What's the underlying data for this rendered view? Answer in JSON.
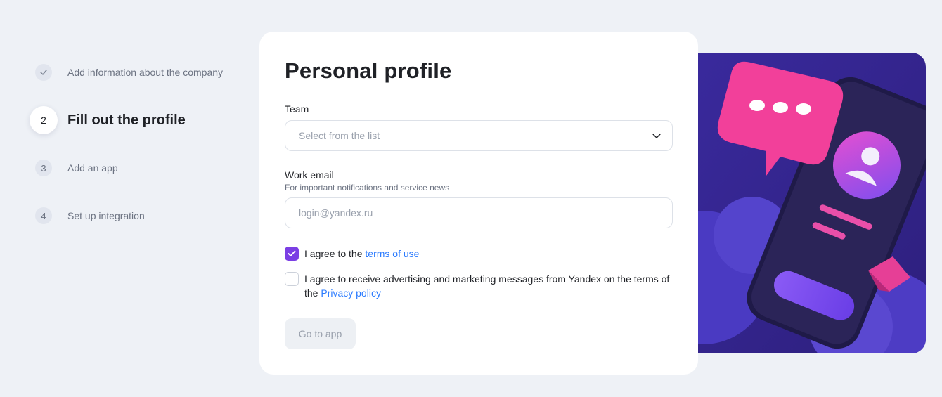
{
  "steps": [
    {
      "number": "",
      "label": "Add information about the company",
      "state": "done"
    },
    {
      "number": "2",
      "label": "Fill out the profile",
      "state": "active"
    },
    {
      "number": "3",
      "label": "Add an app",
      "state": "pending"
    },
    {
      "number": "4",
      "label": "Set up integration",
      "state": "pending"
    }
  ],
  "form": {
    "title": "Personal profile",
    "team": {
      "label": "Team",
      "placeholder": "Select from the list"
    },
    "email": {
      "label": "Work email",
      "hint": "For important notifications and service news",
      "placeholder": "login@yandex.ru",
      "value": ""
    },
    "terms": {
      "checked": true,
      "prefix": "I agree to the ",
      "link": "terms of use"
    },
    "marketing": {
      "checked": false,
      "prefix": "I agree to receive advertising and marketing messages from Yandex on the terms of the ",
      "link": "Privacy policy"
    },
    "submit_label": "Go to app"
  },
  "colors": {
    "accent": "#7b3fe4",
    "link": "#2b7bff",
    "background": "#eef1f6"
  }
}
